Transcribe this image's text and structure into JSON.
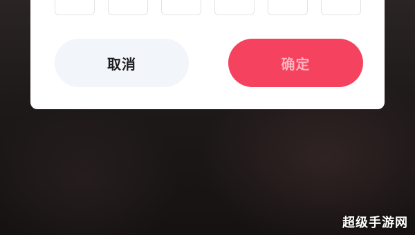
{
  "dialog": {
    "code_boxes": [
      "",
      "",
      "",
      "",
      "",
      ""
    ],
    "cancel_label": "取消",
    "confirm_label": "确定"
  },
  "watermark": {
    "text": "超级手游网"
  },
  "colors": {
    "confirm_button": "#f5425e",
    "confirm_text": "#fbb3be",
    "cancel_button": "#f2f5f9"
  }
}
